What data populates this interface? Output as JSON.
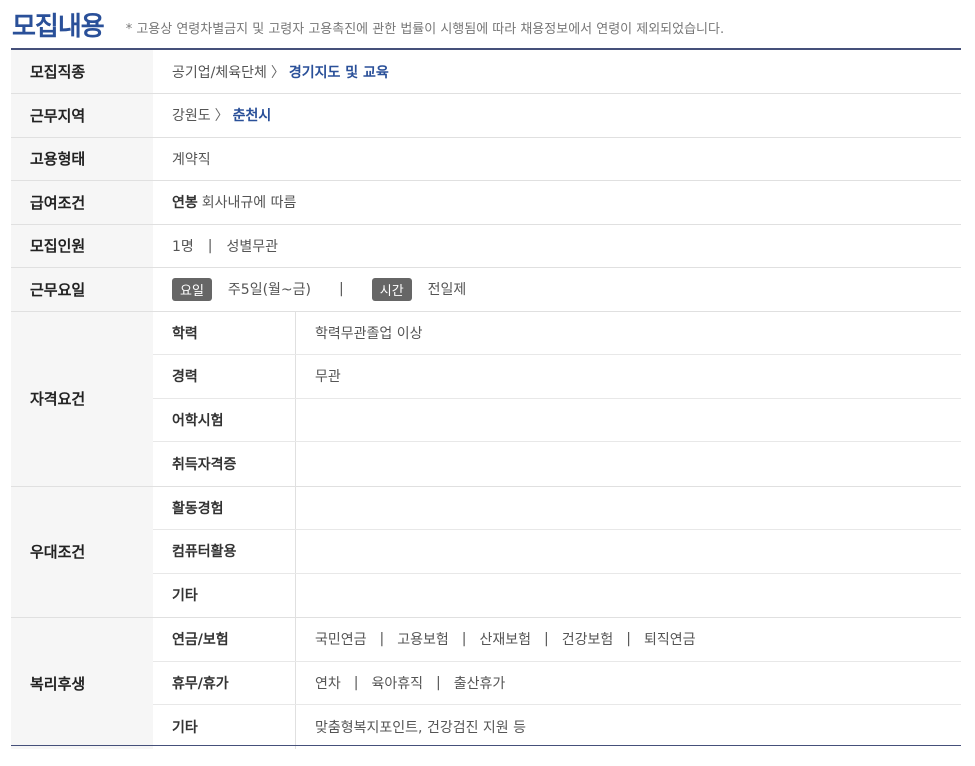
{
  "header": {
    "title": "모집내용",
    "note": "* 고용상 연령차별금지 및 고령자 고용촉진에 관한 법률이 시행됨에 따라 채용정보에서 연령이 제외되었습니다."
  },
  "rows": {
    "job_type": {
      "label": "모집직종",
      "path1": "공기업/체육단체",
      "path2": "경기지도 및 교육"
    },
    "location": {
      "label": "근무지역",
      "path1": "강원도",
      "path2": "춘천시"
    },
    "employment": {
      "label": "고용형태",
      "value": "계약직"
    },
    "salary": {
      "label": "급여조건",
      "kind": "연봉",
      "value": "회사내규에 따름"
    },
    "recruit": {
      "label": "모집인원",
      "count": "1명",
      "sep": "|",
      "gender": "성별무관"
    },
    "workday": {
      "label": "근무요일",
      "day_badge": "요일",
      "day_value": "주5일(월~금)",
      "sep": "|",
      "time_badge": "시간",
      "time_value": "전일제"
    }
  },
  "qualification": {
    "label": "자격요건",
    "items": [
      {
        "label": "학력",
        "value": "학력무관졸업 이상"
      },
      {
        "label": "경력",
        "value": "무관"
      },
      {
        "label": "어학시험",
        "value": ""
      },
      {
        "label": "취득자격증",
        "value": ""
      }
    ]
  },
  "preference": {
    "label": "우대조건",
    "items": [
      {
        "label": "활동경험",
        "value": ""
      },
      {
        "label": "컴퓨터활용",
        "value": ""
      },
      {
        "label": "기타",
        "value": ""
      }
    ]
  },
  "welfare": {
    "label": "복리후생",
    "items": [
      {
        "label": "연금/보험",
        "values": [
          "국민연금",
          "고용보험",
          "산재보험",
          "건강보험",
          "퇴직연금"
        ]
      },
      {
        "label": "휴무/휴가",
        "values": [
          "연차",
          "육아휴직",
          "출산휴가"
        ]
      },
      {
        "label": "기타",
        "values": [
          "맞춤형복지포인트, 건강검진 지원 등"
        ]
      }
    ],
    "sep": "|"
  }
}
